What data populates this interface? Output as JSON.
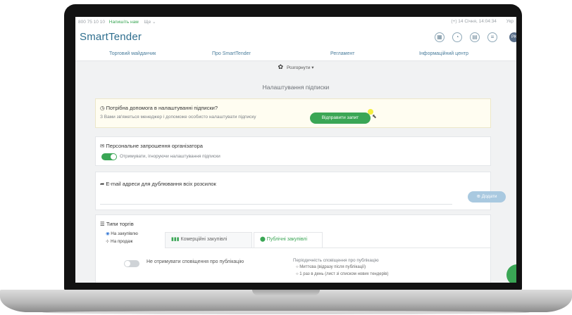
{
  "topbar": {
    "phone": "800 75 10 10",
    "call_link": "Напишіть нам",
    "more": "Ще ⌄",
    "datetime": "(+) 14 Січня, 14:04:34",
    "lang": "Укр"
  },
  "header": {
    "logo": "SmartTender",
    "avatar_initials": "PK"
  },
  "nav": {
    "items": [
      "Торговий майданчик",
      "Про SmartTender",
      "Регламент",
      "Інформаційний центр"
    ]
  },
  "expand_label": "Розгорнути",
  "page_title": "Налаштування підписки",
  "help": {
    "title": "Потрібна допомога в налаштуванні підписки?",
    "text": "З Вами зв'яжеться менеджер і допоможе особисто налаштувати підписку",
    "button": "Відправити запит"
  },
  "invites": {
    "title": "Персональне запрошення організатора",
    "toggle_label": "Отримувати, ігноруючи налаштування підписки"
  },
  "email": {
    "title": "E-mail адреси для дублювання всіх розсилок",
    "value": "",
    "add_button": "Додати"
  },
  "types": {
    "title": "Типи торгів",
    "radio_buy": "На закупівлю",
    "radio_sell": "На продаж",
    "tabs": [
      "Комерційні закупівлі",
      "Публічні закупівлі"
    ],
    "notify_label": "Не отримувати сповіщення про публікацію",
    "freq_title": "Періодичність сповіщення про публікацію",
    "freq_options": [
      "Миттєва (відразу після публікації)",
      "1 раз в день (лист зі списком нових тендерів)"
    ]
  },
  "colors": {
    "brand_blue": "#2e6e8e",
    "accent_green": "#3aa655",
    "button_blue": "#a9c9e0"
  }
}
